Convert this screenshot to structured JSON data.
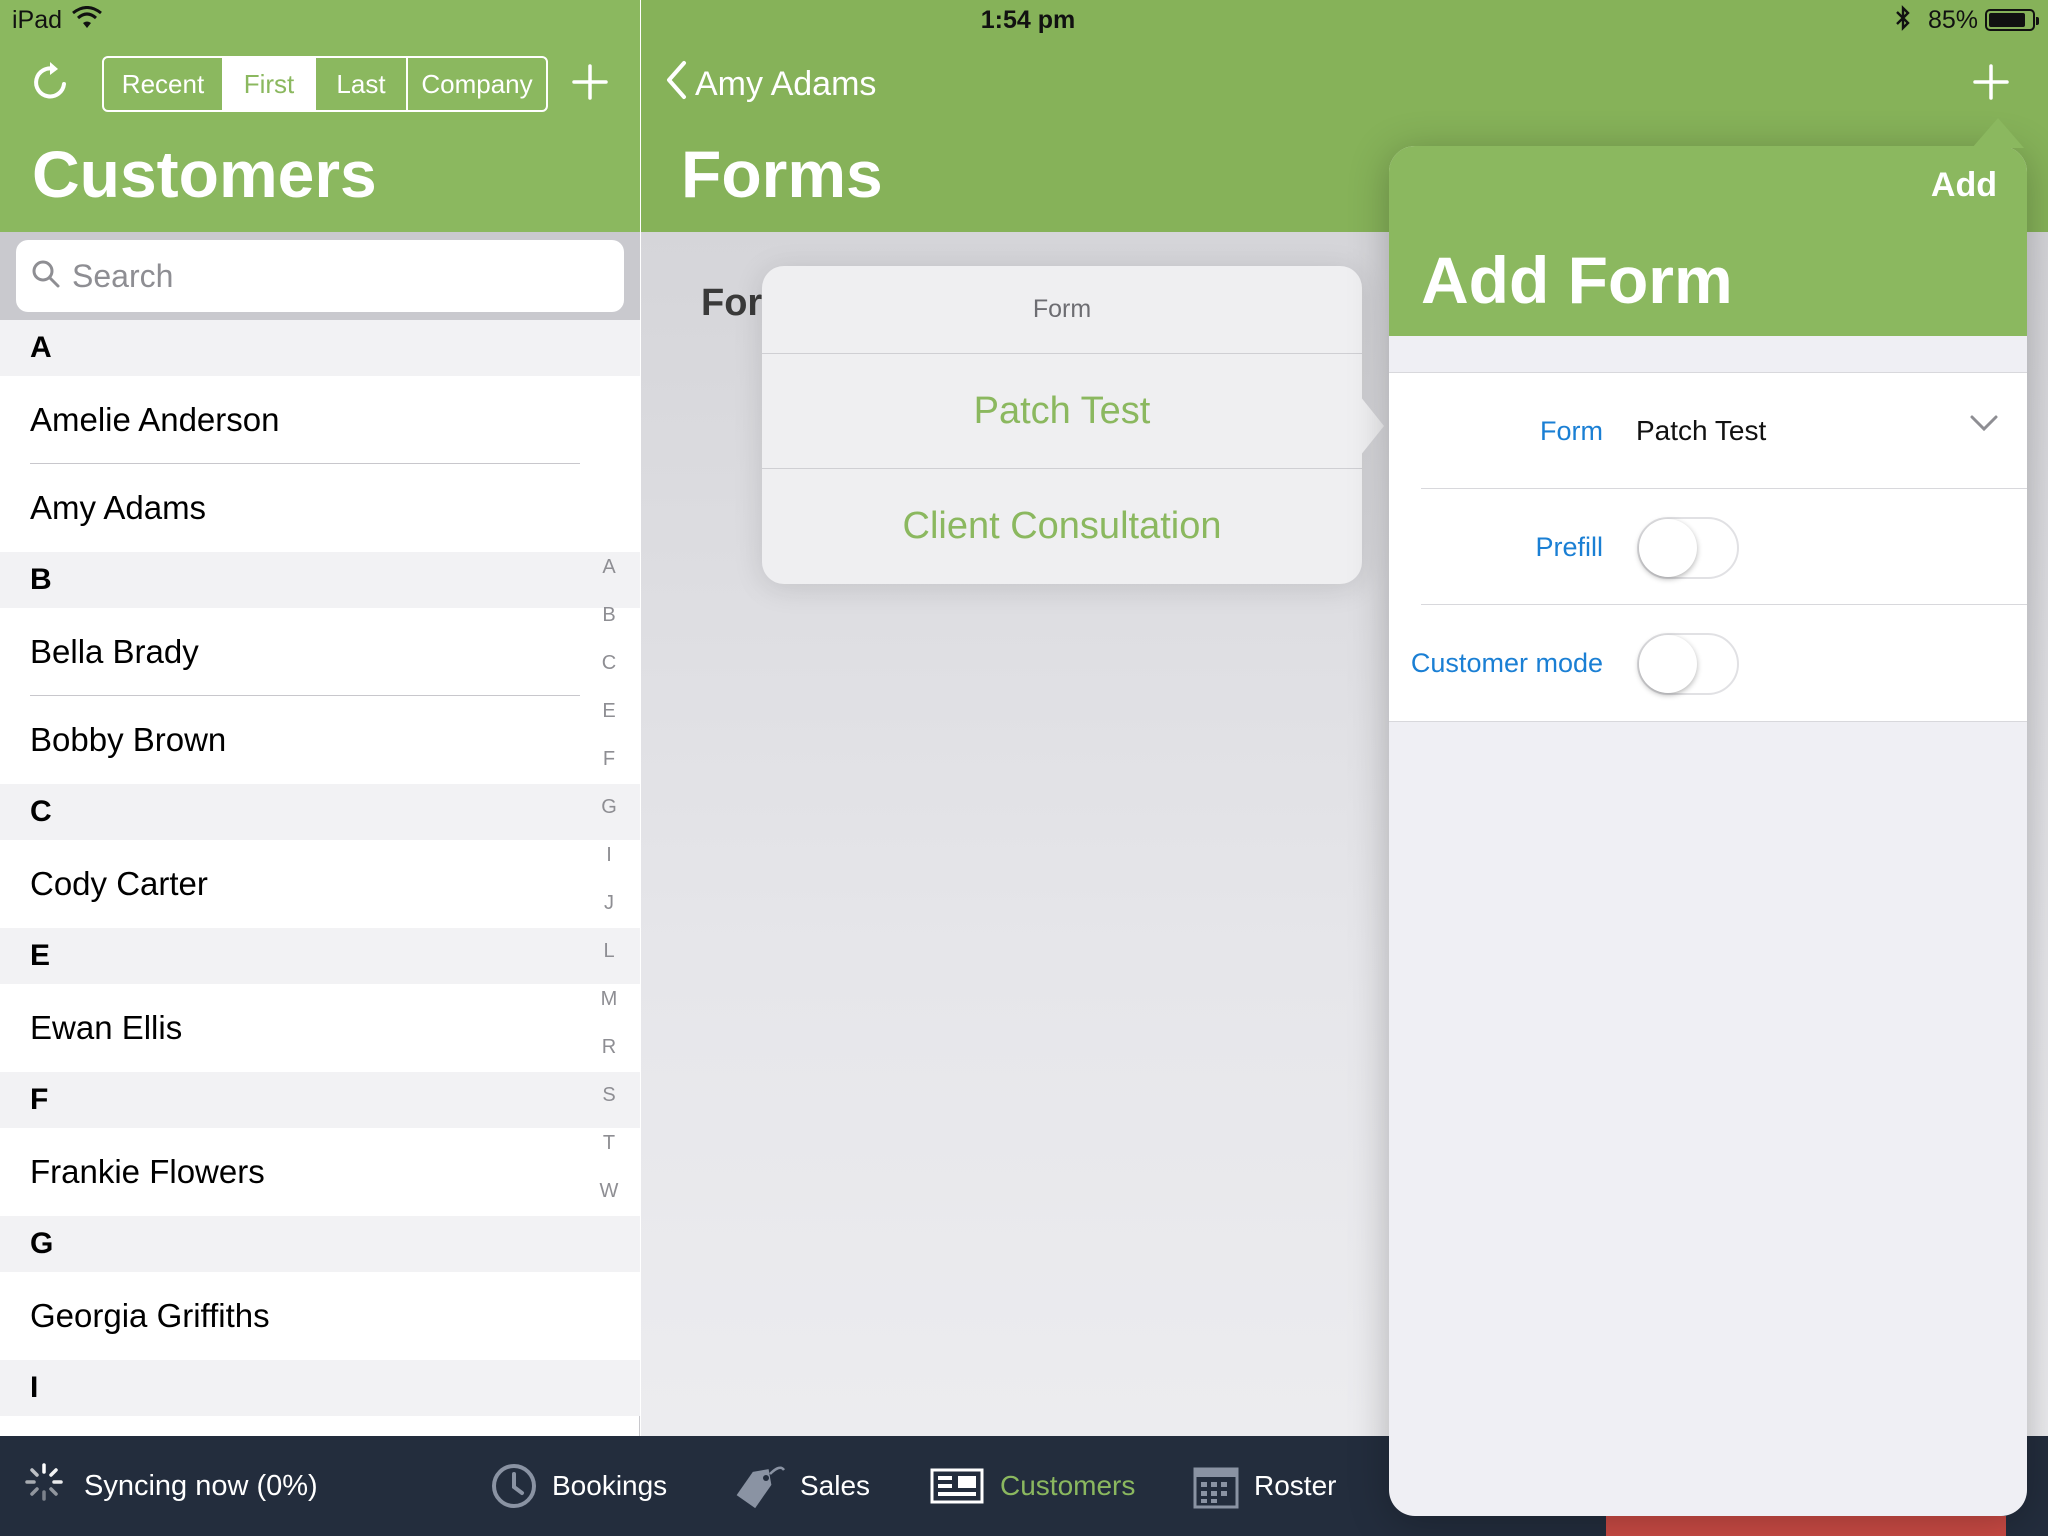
{
  "status_bar": {
    "device": "iPad",
    "time": "1:54 pm",
    "battery_percent": "85%",
    "battery_level": 0.85
  },
  "left_pane": {
    "title": "Customers",
    "segments": [
      {
        "label": "Recent",
        "selected": false
      },
      {
        "label": "First",
        "selected": true
      },
      {
        "label": "Last",
        "selected": false
      },
      {
        "label": "Company",
        "selected": false
      }
    ],
    "search": {
      "placeholder": "Search"
    },
    "sections": [
      {
        "letter": "A",
        "rows": [
          "Amelie Anderson",
          "Amy Adams"
        ]
      },
      {
        "letter": "B",
        "rows": [
          "Bella Brady",
          "Bobby Brown"
        ]
      },
      {
        "letter": "C",
        "rows": [
          "Cody  Carter"
        ]
      },
      {
        "letter": "E",
        "rows": [
          "Ewan Ellis"
        ]
      },
      {
        "letter": "F",
        "rows": [
          "Frankie Flowers"
        ]
      },
      {
        "letter": "G",
        "rows": [
          "Georgia Griffiths"
        ]
      },
      {
        "letter": "I",
        "rows": []
      }
    ],
    "index": [
      "A",
      "B",
      "C",
      "E",
      "F",
      "G",
      "I",
      "J",
      "L",
      "M",
      "R",
      "S",
      "T",
      "W"
    ]
  },
  "right_pane": {
    "back_label": "Amy Adams",
    "title": "Forms",
    "section_label": "For"
  },
  "picker": {
    "title": "Form",
    "options": [
      "Patch Test",
      "Client Consultation"
    ]
  },
  "add_form": {
    "action": "Add",
    "title": "Add Form",
    "rows": {
      "form": {
        "label": "Form",
        "value": "Patch Test"
      },
      "prefill": {
        "label": "Prefill",
        "on": false
      },
      "customer_mode": {
        "label": "Customer mode",
        "on": false
      }
    }
  },
  "tab_bar": {
    "sync_status": "Syncing now (0%)",
    "tabs": [
      {
        "label": "Bookings",
        "icon": "clock-icon"
      },
      {
        "label": "Sales",
        "icon": "price-tag-icon"
      },
      {
        "label": "Customers",
        "icon": "customers-icon",
        "active": true
      },
      {
        "label": "Roster",
        "icon": "calendar-icon"
      }
    ]
  },
  "colors": {
    "brand_green": "#8bb85f",
    "link_blue": "#1a7fd4",
    "tabbar_bg": "#232d3d"
  }
}
